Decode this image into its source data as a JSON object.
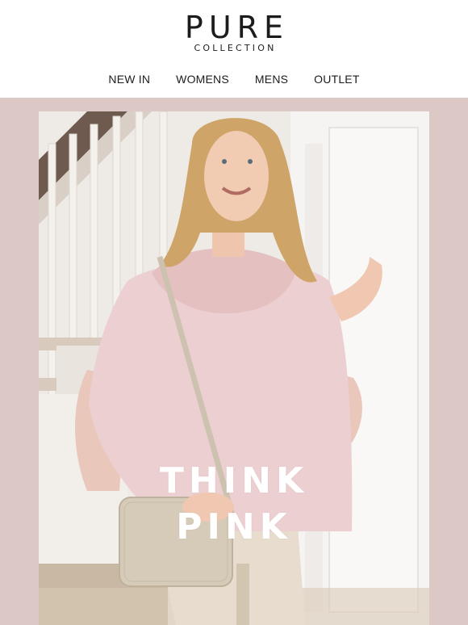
{
  "brand": {
    "name": "PURE",
    "subtitle": "COLLECTION"
  },
  "nav": {
    "items": [
      "NEW IN",
      "WOMENS",
      "MENS",
      "OUTLET"
    ]
  },
  "hero": {
    "headline_line1": "THINK",
    "headline_line2": "PINK"
  },
  "colors": {
    "band": "#dcc8c5",
    "text": "#1c1c1c",
    "headline": "#ffffff"
  }
}
